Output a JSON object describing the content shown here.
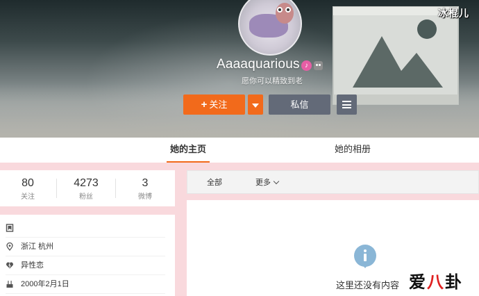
{
  "profile": {
    "username": "Aaaaquarious",
    "bio": "愿你可以精致到老",
    "badge_pink_icon": "vip-badge-icon",
    "badge_gray_icon": "robot-badge-icon"
  },
  "actions": {
    "follow_label": "关注",
    "message_label": "私信"
  },
  "tabs": {
    "home": "她的主页",
    "album": "她的相册"
  },
  "stats": [
    {
      "value": "80",
      "label": "关注"
    },
    {
      "value": "4273",
      "label": "粉丝"
    },
    {
      "value": "3",
      "label": "微博"
    }
  ],
  "info": {
    "location": "浙江 杭州",
    "orientation": "异性恋",
    "birthday": "2000年2月1日"
  },
  "filter": {
    "all": "全部",
    "more": "更多"
  },
  "empty_state": {
    "message": "这里还没有内容"
  },
  "watermarks": {
    "top": "冰棍儿",
    "bottom_a": "爱",
    "bottom_b": "八",
    "bottom_c": "卦"
  },
  "colors": {
    "accent": "#f26a1b",
    "secondary_button": "#636a78",
    "page_background": "#f9d9dd",
    "info_icon": "#8ab6d6"
  }
}
